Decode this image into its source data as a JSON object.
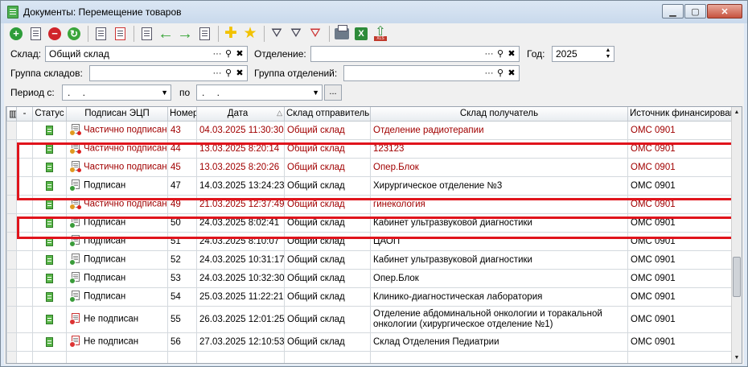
{
  "window": {
    "title": "Документы: Перемещение товаров"
  },
  "filters": {
    "sklad_label": "Склад:",
    "sklad_value": "Общий склад",
    "otdelenie_label": "Отделение:",
    "otdelenie_value": "",
    "year_label": "Год:",
    "year_value": "2025",
    "gruppa_skladov_label": "Группа складов:",
    "gruppa_skladov_value": "",
    "gruppa_otdeleniy_label": "Группа отделений:",
    "gruppa_otdeleniy_value": "",
    "period_label": "Период с:",
    "period_from": " .  .",
    "period_to_label": "по",
    "period_to": " .  .",
    "ellipsis": "...",
    "lookup_dots": "···"
  },
  "grid": {
    "headers": [
      "-",
      "Статус",
      "Подписан ЭЦП",
      "Номер",
      "Дата",
      "Склад отправитель",
      "Склад получатель",
      "Источник финансирования"
    ],
    "sort_marker": "△",
    "rows": [
      {
        "sig": "part",
        "signed": "Частично подписан",
        "num": "43",
        "date": "04.03.2025 11:30:30",
        "from": "Общий склад",
        "to": "Отделение радиотерапии",
        "fin": "ОМС 0901",
        "red": true
      },
      {
        "sig": "part",
        "signed": "Частично подписан",
        "num": "44",
        "date": "13.03.2025 8:20:14",
        "from": "Общий склад",
        "to": "123123",
        "fin": "ОМС 0901",
        "red": true
      },
      {
        "sig": "part",
        "signed": "Частично подписан",
        "num": "45",
        "date": "13.03.2025 8:20:26",
        "from": "Общий склад",
        "to": "Опер.Блок",
        "fin": "ОМС 0901",
        "red": true
      },
      {
        "sig": "full",
        "signed": "Подписан",
        "num": "47",
        "date": "14.03.2025 13:24:23",
        "from": "Общий склад",
        "to": "Хирургическое отделение  №3",
        "fin": "ОМС 0901",
        "red": false
      },
      {
        "sig": "part",
        "signed": "Частично подписан",
        "num": "49",
        "date": "21.03.2025 12:37:49",
        "from": "Общий склад",
        "to": "гинекология",
        "fin": "ОМС 0901",
        "red": true
      },
      {
        "sig": "full",
        "signed": "Подписан",
        "num": "50",
        "date": "24.03.2025 8:02:41",
        "from": "Общий склад",
        "to": "Кабинет ультразвуковой диагностики",
        "fin": "ОМС 0901",
        "red": false
      },
      {
        "sig": "full",
        "signed": "Подписан",
        "num": "51",
        "date": "24.03.2025 8:10:07",
        "from": "Общий склад",
        "to": "ЦАОП",
        "fin": "ОМС 0901",
        "red": false
      },
      {
        "sig": "full",
        "signed": "Подписан",
        "num": "52",
        "date": "24.03.2025 10:31:17",
        "from": "Общий склад",
        "to": "Кабинет ультразвуковой диагностики",
        "fin": "ОМС 0901",
        "red": false
      },
      {
        "sig": "full",
        "signed": "Подписан",
        "num": "53",
        "date": "24.03.2025 10:32:30",
        "from": "Общий склад",
        "to": "Опер.Блок",
        "fin": "ОМС 0901",
        "red": false
      },
      {
        "sig": "full",
        "signed": "Подписан",
        "num": "54",
        "date": "25.03.2025 11:22:21",
        "from": "Общий склад",
        "to": "Клинико-диагностическая лаборатория",
        "fin": "ОМС 0901",
        "red": false
      },
      {
        "sig": "none",
        "signed": "Не подписан",
        "num": "55",
        "date": "26.03.2025 12:01:25",
        "from": "Общий склад",
        "to": "Отделение абдоминальной онкологии и торакальной онкологии (хирургическое отделение №1)",
        "fin": "ОМС 0901",
        "red": false,
        "tall": true
      },
      {
        "sig": "none",
        "signed": "Не подписан",
        "num": "56",
        "date": "27.03.2025 12:10:53",
        "from": "Общий склад",
        "to": "Склад Отделения Педиатрии",
        "fin": "ОМС 0901",
        "red": false
      }
    ]
  },
  "colors": {
    "highlight": "#e0141c",
    "partial_text": "#a10000"
  }
}
